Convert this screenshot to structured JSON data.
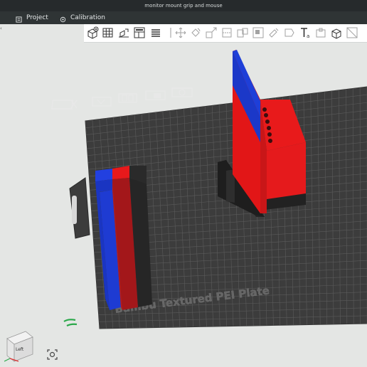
{
  "window": {
    "title": "monitor mount grip and mouse"
  },
  "tabs": [
    {
      "label": "Project",
      "icon": "project-icon"
    },
    {
      "label": "Calibration",
      "icon": "calibration-icon"
    }
  ],
  "toolbar": {
    "icons": [
      "add-object-icon",
      "arrange-grid-icon",
      "auto-orient-icon",
      "plate-layout-icon",
      "list-icon",
      "move-icon",
      "rotate-icon",
      "scale-icon",
      "cut-icon",
      "split-objects-icon",
      "split-parts-icon",
      "support-paint-icon",
      "seam-paint-icon",
      "text-icon",
      "assembly-icon",
      "measure-icon",
      "explode-icon"
    ]
  },
  "bed": {
    "label": "Bambu Textured PEI Plate"
  },
  "view": {
    "label": "Left"
  },
  "colors": {
    "bed": "#3c3c3c",
    "grid": "#5b5b5b",
    "red": "#e21617",
    "blue": "#1e3fd8",
    "black": "#222222",
    "accent_green": "#2aa84a"
  }
}
